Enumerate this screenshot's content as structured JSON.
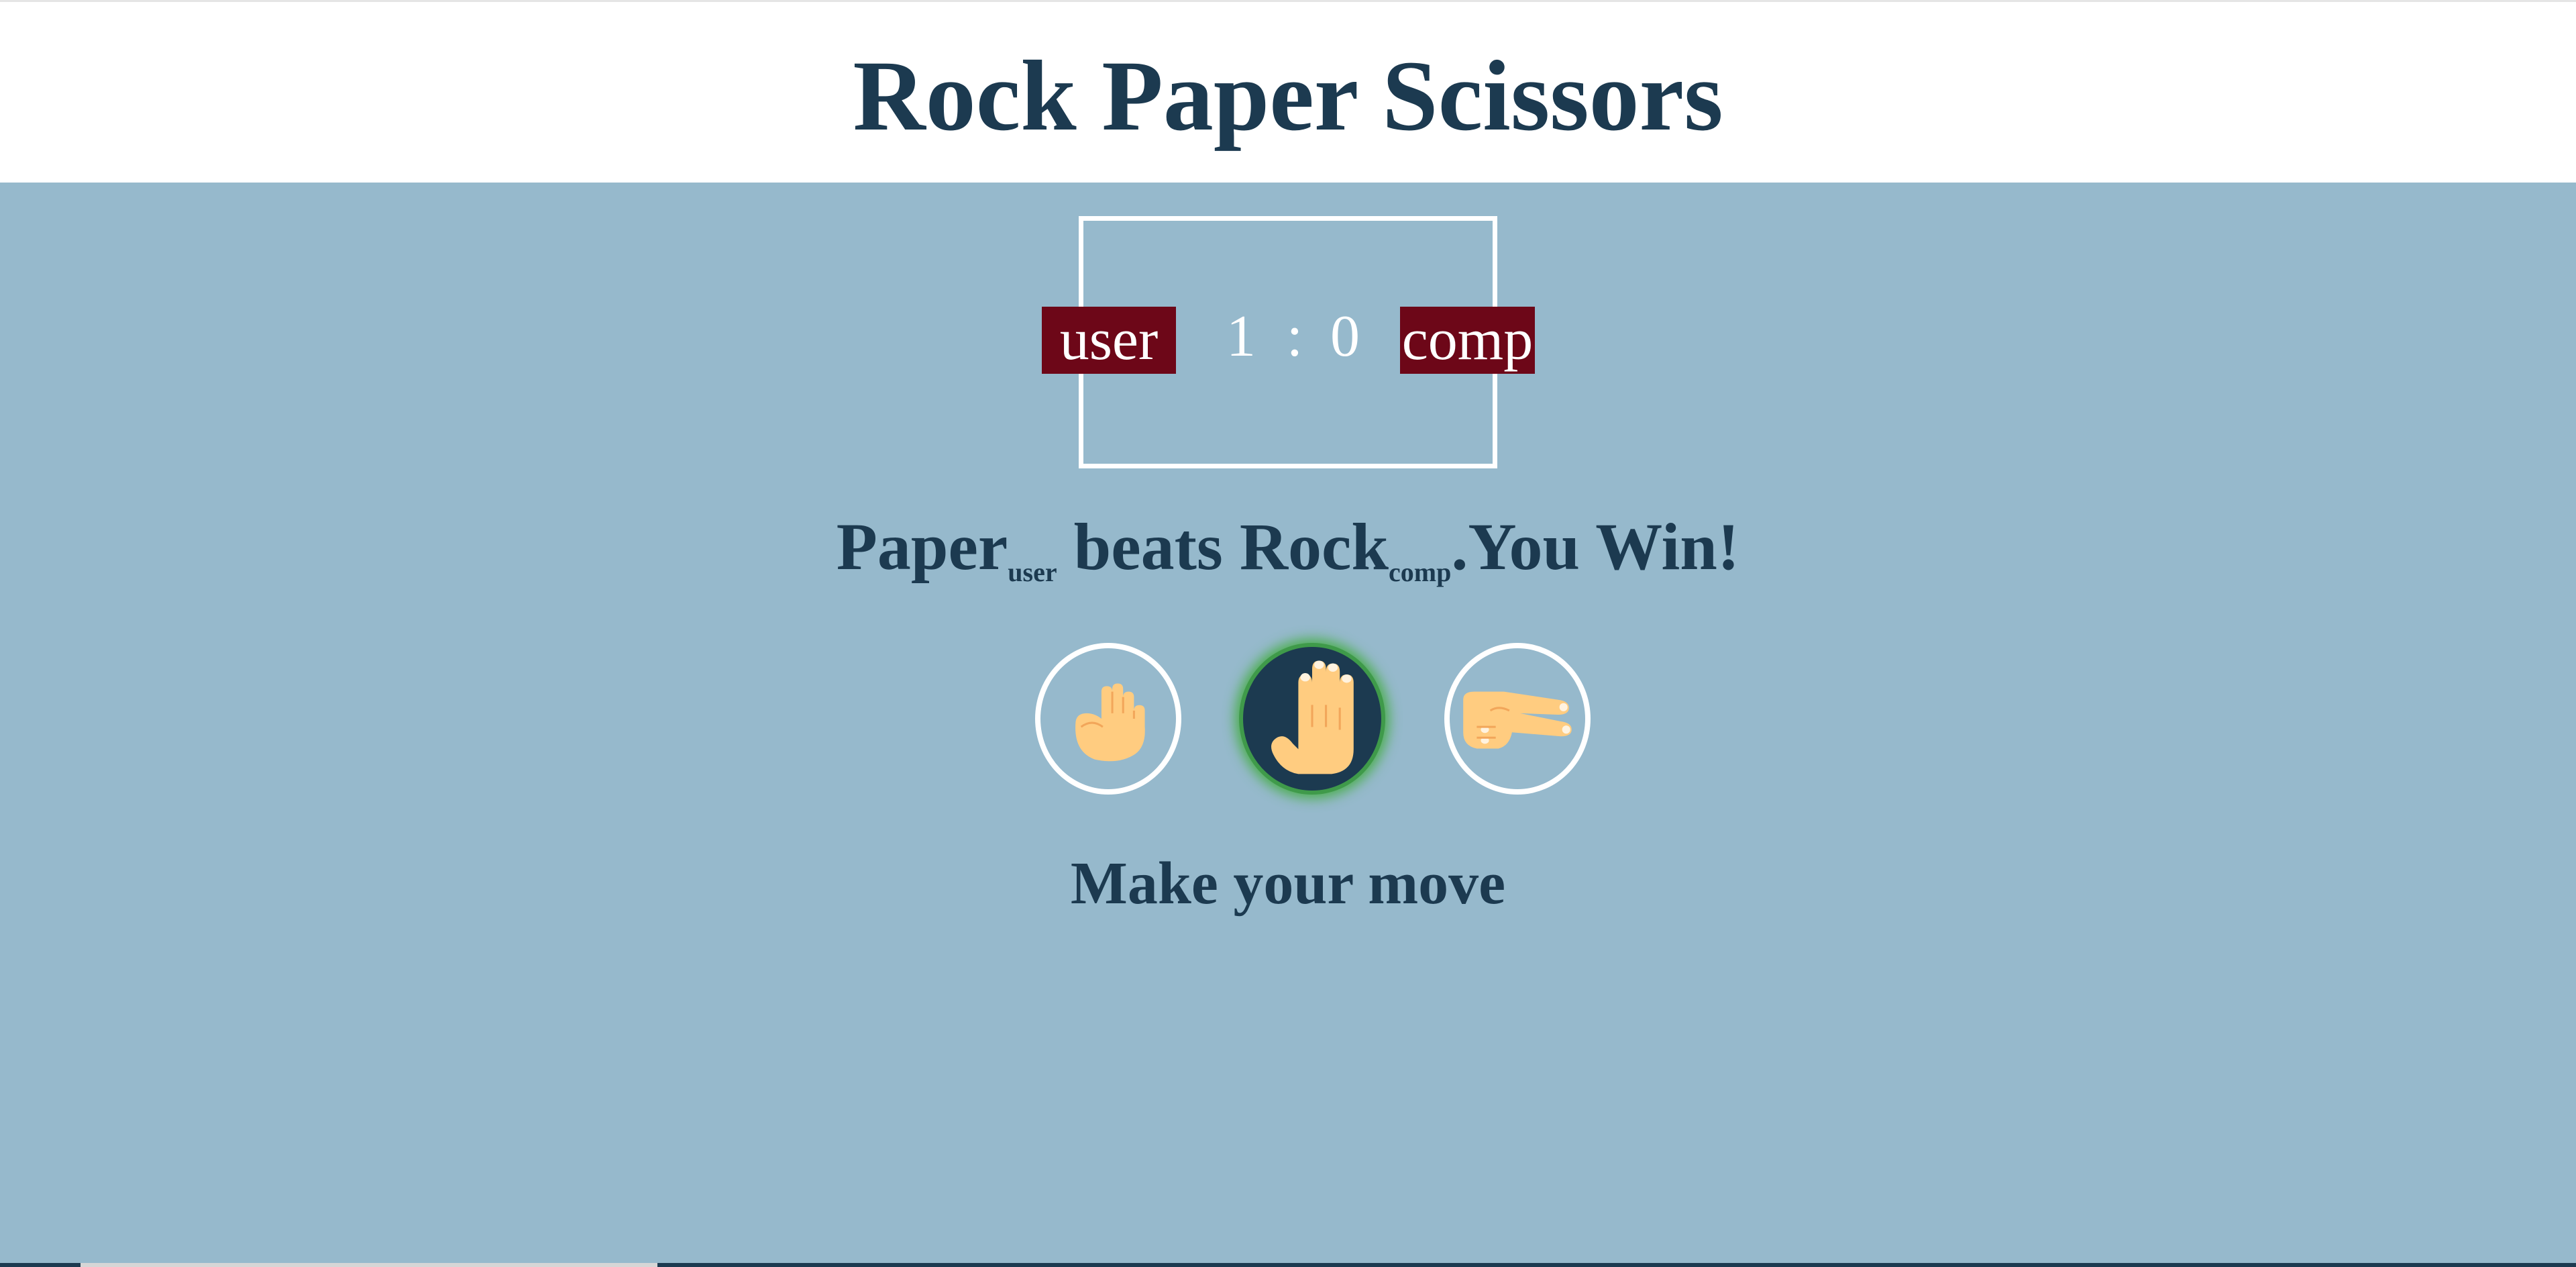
{
  "header": {
    "title": "Rock Paper Scissors"
  },
  "scoreboard": {
    "user_label": "user",
    "comp_label": "comp",
    "user_score": "1",
    "separator": ":",
    "comp_score": "0"
  },
  "result": {
    "user_move": "Paper",
    "user_tag": "user",
    "verb": " beats ",
    "comp_move": "Rock",
    "comp_tag": "comp",
    "outcome": ".You Win!"
  },
  "choices": [
    {
      "name": "rock",
      "icon": "fist-hand-icon",
      "selected": false
    },
    {
      "name": "paper",
      "icon": "open-hand-icon",
      "selected": true
    },
    {
      "name": "scissors",
      "icon": "peace-hand-icon",
      "selected": false
    }
  ],
  "prompt": "Make your move",
  "colors": {
    "title": "#1c3a50",
    "background": "#96b9cc",
    "badge": "#6d0718",
    "selected_glow": "#4cae4f",
    "skin": "#ffcc80"
  }
}
